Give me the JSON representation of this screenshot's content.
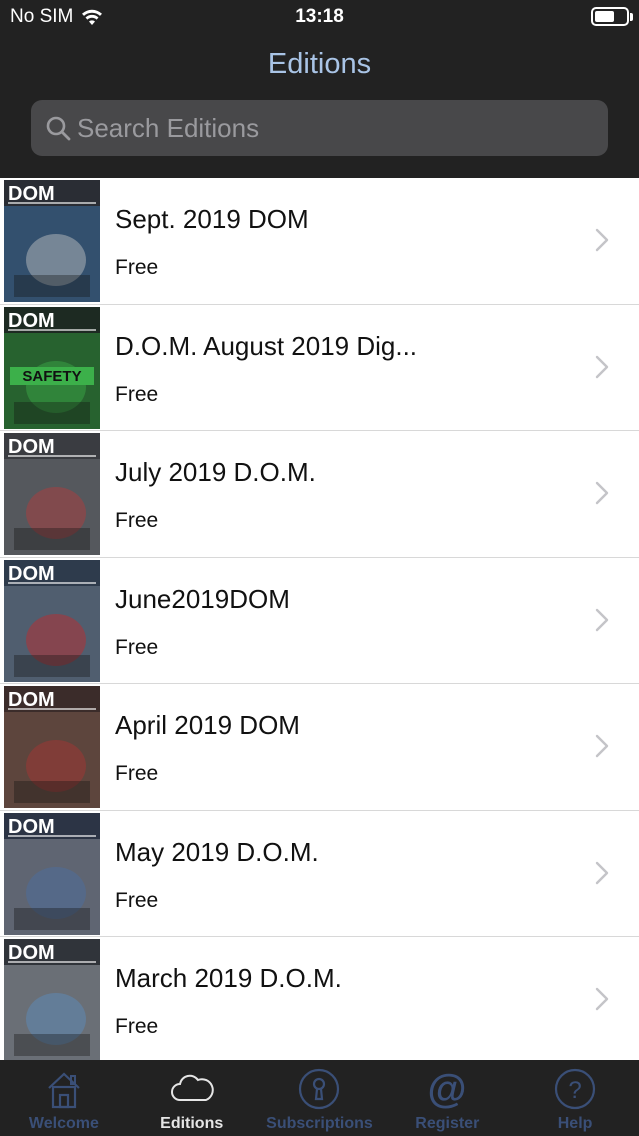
{
  "status": {
    "carrier": "No SIM",
    "time": "13:18",
    "battery_level": 0.62
  },
  "nav": {
    "title": "Editions"
  },
  "search": {
    "placeholder": "Search Editions"
  },
  "editions": [
    {
      "title": "Sept. 2019 DOM",
      "price": "Free",
      "cover": {
        "masthead": "DOM",
        "bg": "#2a2d34",
        "accent": "#c8c8c8",
        "art": "#3b6e9e"
      }
    },
    {
      "title": "D.O.M. August 2019 Dig...",
      "price": "Free",
      "cover": {
        "masthead": "DOM",
        "bg": "#1d2a22",
        "accent": "#3cb04a",
        "art": "#2f8f3a",
        "caption": "SAFETY"
      }
    },
    {
      "title": "July 2019 D.O.M.",
      "price": "Free",
      "cover": {
        "masthead": "DOM",
        "bg": "#3a3c41",
        "accent": "#b73a3a",
        "art": "#6c6f75"
      }
    },
    {
      "title": "June2019DOM",
      "price": "Free",
      "cover": {
        "masthead": "DOM",
        "bg": "#2e3b4c",
        "accent": "#c62828",
        "art": "#6d7b8d"
      }
    },
    {
      "title": "April 2019 DOM",
      "price": "Free",
      "cover": {
        "masthead": "DOM",
        "bg": "#3b2c2a",
        "accent": "#a33",
        "art": "#7a5b4d"
      }
    },
    {
      "title": "May 2019 D.O.M.",
      "price": "Free",
      "cover": {
        "masthead": "DOM",
        "bg": "#2c3445",
        "accent": "#4a6fa5",
        "art": "#8a8e98"
      }
    },
    {
      "title": "March 2019 D.O.M.",
      "price": "Free",
      "cover": {
        "masthead": "DOM",
        "bg": "#30343a",
        "accent": "#5a8fc4",
        "art": "#9aa0a8"
      }
    }
  ],
  "tabs": [
    {
      "label": "Welcome",
      "icon": "house-icon"
    },
    {
      "label": "Editions",
      "icon": "cloud-icon",
      "active": true
    },
    {
      "label": "Subscriptions",
      "icon": "keyhole-icon"
    },
    {
      "label": "Register",
      "icon": "at-sign-icon"
    },
    {
      "label": "Help",
      "icon": "question-icon"
    }
  ],
  "colors": {
    "nav_title": "#a9c4e6",
    "tab_inactive": "#3a4f77",
    "tab_active": "#e6e6e6",
    "chrome_bg": "#222222"
  }
}
